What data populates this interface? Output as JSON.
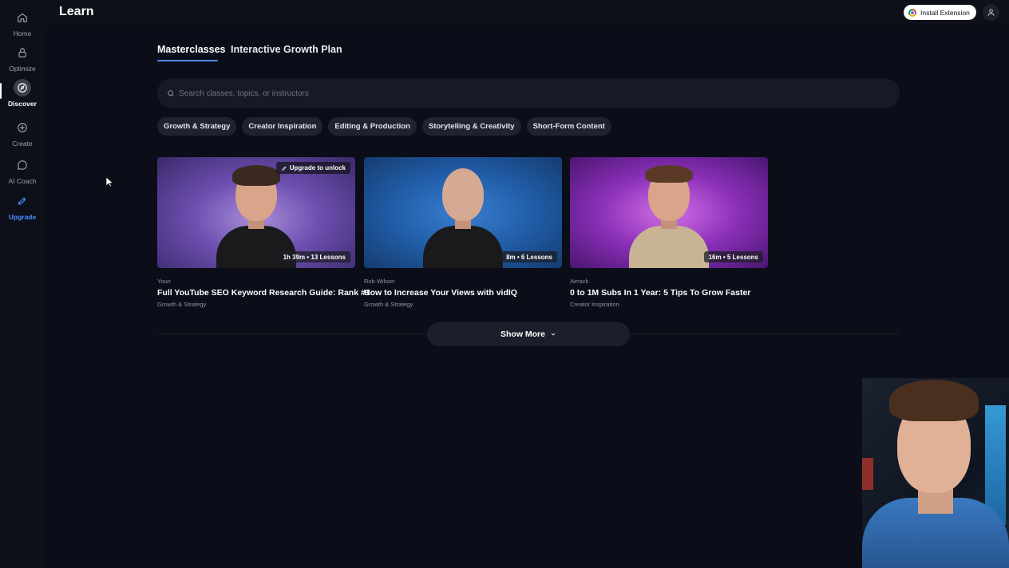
{
  "sidebar": {
    "items": [
      {
        "label": "Home",
        "icon": "home-icon"
      },
      {
        "label": "Optimize",
        "icon": "lock-icon"
      },
      {
        "label": "Discover",
        "icon": "compass-icon",
        "active": true
      },
      {
        "label": "Create",
        "icon": "plus-circle-icon"
      },
      {
        "label": "AI Coach",
        "icon": "chat-icon"
      },
      {
        "label": "Upgrade",
        "icon": "rocket-icon",
        "accent": "#4f8cff"
      }
    ]
  },
  "header": {
    "title": "Learn",
    "install_label": "Install Extension",
    "user_icon": "user-icon"
  },
  "tabs": [
    {
      "label": "Masterclasses",
      "active": true
    },
    {
      "label": "Interactive Growth Plan"
    }
  ],
  "search": {
    "placeholder": "Search classes, topics, or instructors"
  },
  "chips": [
    "Growth & Strategy",
    "Creator Inspiration",
    "Editing & Production",
    "Storytelling & Creativity",
    "Short-Form Content"
  ],
  "courses": [
    {
      "instructor": "Youri",
      "title": "Full YouTube SEO Keyword Research Guide: Rank #1",
      "category": "Growth & Strategy",
      "duration": "1h 39m • 13 Lessons",
      "badge": "Upgrade to unlock"
    },
    {
      "instructor": "Rob Wilson",
      "title": "How to Increase Your Views with vidIQ",
      "category": "Growth & Strategy",
      "duration": "8m • 6 Lessons"
    },
    {
      "instructor": "Airrack",
      "title": "0 to 1M Subs In 1 Year: 5 Tips To Grow Faster",
      "category": "Creator Inspiration",
      "duration": "16m • 5 Lessons"
    }
  ],
  "show_more_label": "Show More",
  "colors": {
    "background": "#0b0e18",
    "accent": "#4f8cff",
    "chip_bg": "#1f2330"
  }
}
